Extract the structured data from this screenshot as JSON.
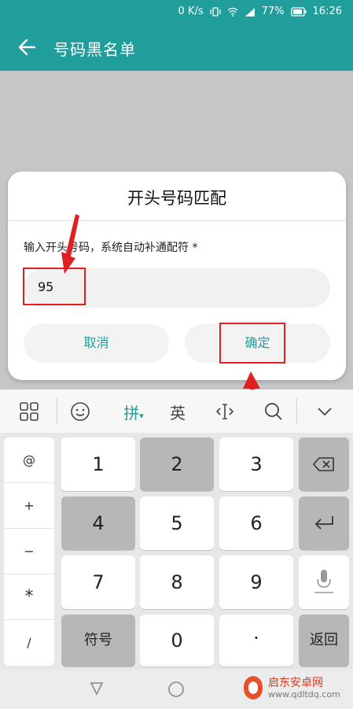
{
  "status": {
    "speed": "0 K/s",
    "battery": "77%",
    "time": "16:26"
  },
  "appbar": {
    "title": "号码黑名单"
  },
  "dialog": {
    "title": "开头号码匹配",
    "hint": "输入开头号码，系统自动补通配符 *",
    "input_value": "95",
    "cancel_label": "取消",
    "ok_label": "确定"
  },
  "toolbar": {
    "pinyin": "拼",
    "english": "英"
  },
  "keyboard": {
    "symbols": [
      "@",
      "+",
      "−",
      "*",
      "/"
    ],
    "digits": [
      "1",
      "2",
      "3",
      "4",
      "5",
      "6",
      "7",
      "8",
      "9",
      "0"
    ],
    "symbol_key": "符号",
    "dot_key": "·",
    "return_key": "返回"
  },
  "watermark": {
    "name": "启东安卓网",
    "url": "www.qdltdq.com"
  },
  "colors": {
    "accent": "#1f9e9c",
    "annotation": "#e02020"
  }
}
